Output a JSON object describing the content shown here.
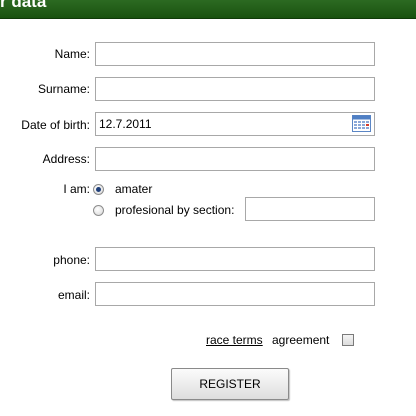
{
  "header": {
    "title": "r data"
  },
  "form": {
    "name_label": "Name:",
    "surname_label": "Surname:",
    "dob_label": "Date of birth:",
    "dob_value": "12.7.2011",
    "address_label": "Address:",
    "iam_label": "I am:",
    "option_amater": "amater",
    "option_profesional": "profesional by section:",
    "phone_label": "phone:",
    "email_label": "email:",
    "terms_link": "race terms",
    "agreement_label": "agreement",
    "register_button": "REGISTER"
  },
  "colors": {
    "header": "#1f5a17",
    "border": "#a8a8a8"
  }
}
